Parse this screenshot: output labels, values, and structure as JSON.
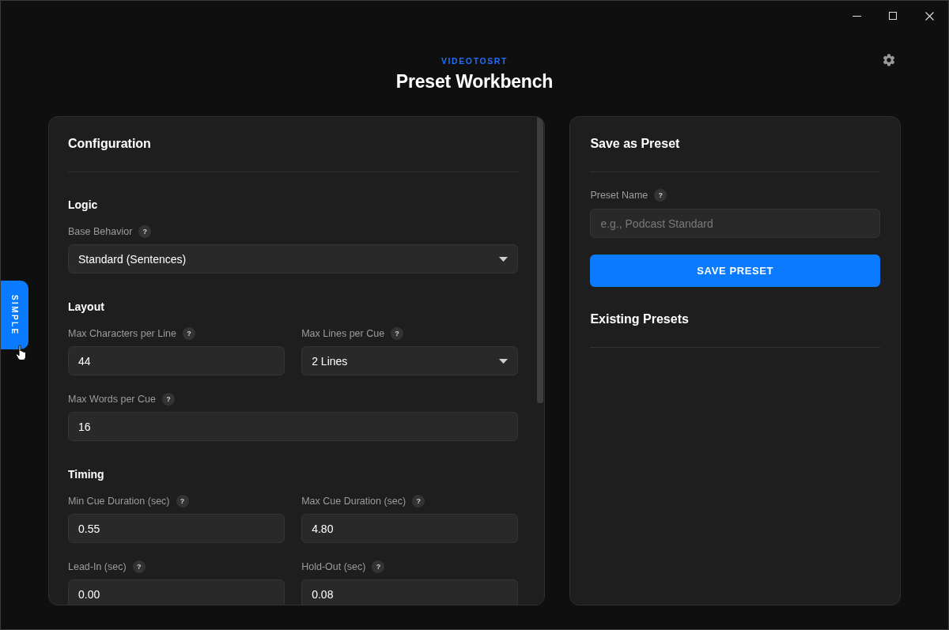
{
  "header": {
    "brand": "VIDEOTOSRT",
    "title": "Preset Workbench"
  },
  "mode_tab": {
    "label": "SIMPLE"
  },
  "configuration": {
    "title": "Configuration",
    "sections": [
      {
        "title": "Logic",
        "rows": [
          {
            "fields": [
              {
                "label": "Base Behavior",
                "help": "?",
                "kind": "select",
                "value": "Standard (Sentences)"
              }
            ]
          }
        ]
      },
      {
        "title": "Layout",
        "rows": [
          {
            "fields": [
              {
                "label": "Max Characters per Line",
                "help": "?",
                "kind": "input",
                "value": "44"
              },
              {
                "label": "Max Lines per Cue",
                "help": "?",
                "kind": "select",
                "value": "2 Lines"
              }
            ]
          },
          {
            "fields": [
              {
                "label": "Max Words per Cue",
                "help": "?",
                "kind": "input",
                "value": "16"
              }
            ]
          }
        ]
      },
      {
        "title": "Timing",
        "rows": [
          {
            "fields": [
              {
                "label": "Min Cue Duration (sec)",
                "help": "?",
                "kind": "input",
                "value": "0.55"
              },
              {
                "label": "Max Cue Duration (sec)",
                "help": "?",
                "kind": "input",
                "value": "4.80"
              }
            ]
          },
          {
            "fields": [
              {
                "label": "Lead-In (sec)",
                "help": "?",
                "kind": "input",
                "value": "0.00"
              },
              {
                "label": "Hold-Out (sec)",
                "help": "?",
                "kind": "input",
                "value": "0.08"
              }
            ]
          }
        ]
      }
    ]
  },
  "save_preset": {
    "title": "Save as Preset",
    "name_field": {
      "label": "Preset Name",
      "help": "?",
      "placeholder": "e.g., Podcast Standard"
    },
    "button": "SAVE PRESET"
  },
  "existing_presets": {
    "title": "Existing Presets"
  }
}
